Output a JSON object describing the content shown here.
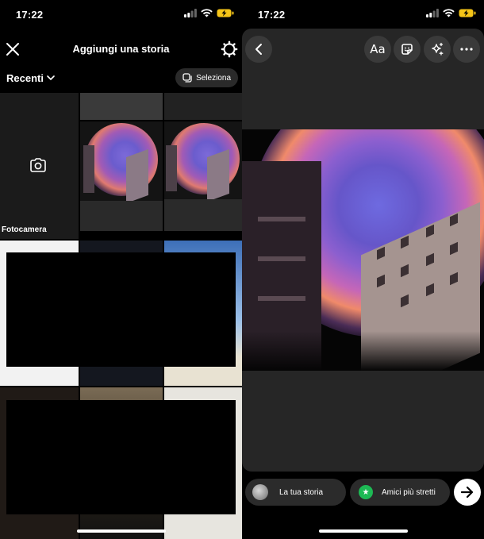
{
  "left": {
    "status": {
      "time": "17:22"
    },
    "header": {
      "title": "Aggiungi una storia"
    },
    "album": {
      "label": "Recenti"
    },
    "select_label": "Seleziona",
    "camera_label": "Fotocamera"
  },
  "right": {
    "status": {
      "time": "17:22"
    },
    "tools": {
      "text_label": "Aa"
    },
    "share": {
      "story_label": "La tua storia",
      "close_friends_label": "Amici più stretti"
    }
  },
  "colors": {
    "background": "#000000",
    "surface": "#262626",
    "chip": "#2b2b2b",
    "close_friends_green": "#1db954",
    "battery_yellow": "#f5c518"
  },
  "icons": {
    "close": "close-icon",
    "settings": "gear-icon",
    "chevron": "chevron-down-icon",
    "select": "multi-select-icon",
    "camera": "camera-icon",
    "back": "chevron-left-icon",
    "sticker": "sticker-icon",
    "effects": "sparkles-icon",
    "more": "more-icon",
    "next": "arrow-right-icon"
  }
}
